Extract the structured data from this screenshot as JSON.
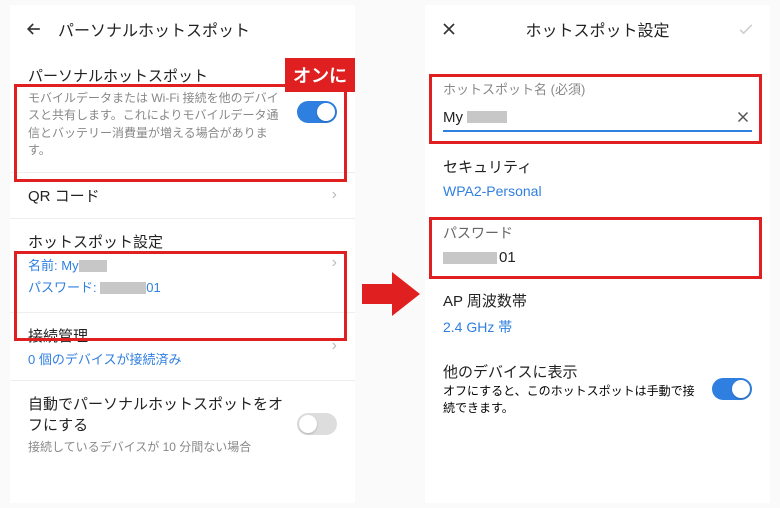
{
  "left": {
    "title": "パーソナルホットスポット",
    "hotspot": {
      "label": "パーソナルホットスポット",
      "desc": "モバイルデータまたは Wi-Fi 接続を他のデバイスと共有します。これによりモバイルデータ通信とバッテリー消費量が増える場合があります。",
      "on": true
    },
    "qr": {
      "label": "QR コード"
    },
    "settings": {
      "label": "ホットスポット設定",
      "name_label": "名前:",
      "name_value": "My",
      "password_label": "パスワード:",
      "password_suffix": "01"
    },
    "mgmt": {
      "label": "接続管理",
      "status": "0 個のデバイスが接続済み"
    },
    "auto_off": {
      "label": "自動でパーソナルホットスポットをオフにする",
      "sub": "接続しているデバイスが 10 分間ない場合"
    }
  },
  "right": {
    "title": "ホットスポット設定",
    "name_field": {
      "label": "ホットスポット名 (必須)",
      "value": "My"
    },
    "security": {
      "label": "セキュリティ",
      "value": "WPA2-Personal"
    },
    "password": {
      "label": "パスワード",
      "suffix": "01"
    },
    "band": {
      "label": "AP 周波数帯",
      "value": "2.4 GHz 帯"
    },
    "visible": {
      "label": "他のデバイスに表示",
      "sub": "オフにすると、このホットスポットは手動で接続できます。",
      "on": true
    }
  },
  "annotation": {
    "on_badge": "オンに"
  }
}
